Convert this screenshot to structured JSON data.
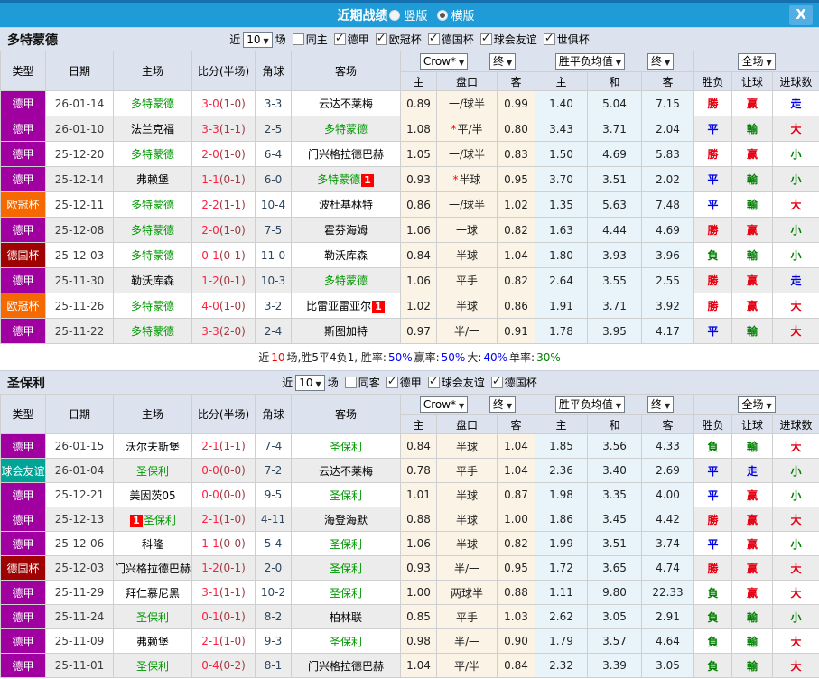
{
  "ui": {
    "arrow": "▼",
    "title": "近期战绩",
    "radio_vertical": "竖版",
    "radio_horizontal": "横版",
    "selected_layout": "横版",
    "close": "X",
    "near": "近",
    "games": "场"
  },
  "league_colors": {
    "德甲": "#a000a0",
    "欧冠杯": "#f56a00",
    "德国杯": "#9e0202",
    "球会友谊": "#00a496"
  },
  "result_colors": {
    "win_red": "#e60012",
    "lose_green": "#008000",
    "draw_blue": "#0000e6"
  },
  "table_header": {
    "type": "类型",
    "date": "日期",
    "home": "主场",
    "score": "比分(半场)",
    "corner": "角球",
    "away": "客场",
    "crow": "Crow*",
    "final1": "终",
    "avg": "胜平负均值",
    "final2": "终",
    "full": "全场",
    "sub": [
      "主",
      "盘口",
      "客",
      "主",
      "和",
      "客",
      "胜负",
      "让球",
      "进球数"
    ]
  },
  "sections": [
    {
      "team": "多特蒙德",
      "games_count": "10",
      "same_label": "同主",
      "same_checked": false,
      "leagues": [
        "德甲",
        "欧冠杯",
        "德国杯",
        "球会友谊",
        "世俱杯"
      ],
      "rows": [
        {
          "league": "德甲",
          "date": "26-01-14",
          "home": {
            "name": "多特蒙德",
            "green": true
          },
          "away": {
            "name": "云达不莱梅"
          },
          "score": "3-0",
          "half": "(1-0)",
          "corner": "3-3",
          "odds": [
            "0.89",
            "一/球半",
            "0.99"
          ],
          "star": false,
          "avg": [
            "1.40",
            "5.04",
            "7.15"
          ],
          "res": [
            [
              "勝",
              "r"
            ],
            [
              "赢",
              "r"
            ],
            [
              "走",
              "b"
            ]
          ]
        },
        {
          "league": "德甲",
          "date": "26-01-10",
          "home": {
            "name": "法兰克福"
          },
          "away": {
            "name": "多特蒙德",
            "green": true
          },
          "score": "3-3",
          "half": "(1-1)",
          "corner": "2-5",
          "odds": [
            "1.08",
            "平/半",
            "0.80"
          ],
          "star": true,
          "avg": [
            "3.43",
            "3.71",
            "2.04"
          ],
          "res": [
            [
              "平",
              "b"
            ],
            [
              "輸",
              "g"
            ],
            [
              "大",
              "r"
            ]
          ]
        },
        {
          "league": "德甲",
          "date": "25-12-20",
          "home": {
            "name": "多特蒙德",
            "green": true
          },
          "away": {
            "name": "门兴格拉德巴赫"
          },
          "score": "2-0",
          "half": "(1-0)",
          "corner": "6-4",
          "odds": [
            "1.05",
            "一/球半",
            "0.83"
          ],
          "star": false,
          "avg": [
            "1.50",
            "4.69",
            "5.83"
          ],
          "res": [
            [
              "勝",
              "r"
            ],
            [
              "赢",
              "r"
            ],
            [
              "小",
              "g"
            ]
          ]
        },
        {
          "league": "德甲",
          "date": "25-12-14",
          "home": {
            "name": "弗赖堡"
          },
          "away": {
            "name": "多特蒙德",
            "green": true,
            "badge": "1",
            "badge_pos": "after"
          },
          "score": "1-1",
          "half": "(0-1)",
          "corner": "6-0",
          "odds": [
            "0.93",
            "半球",
            "0.95"
          ],
          "star": true,
          "avg": [
            "3.70",
            "3.51",
            "2.02"
          ],
          "res": [
            [
              "平",
              "b"
            ],
            [
              "輸",
              "g"
            ],
            [
              "小",
              "g"
            ]
          ]
        },
        {
          "league": "欧冠杯",
          "date": "25-12-11",
          "home": {
            "name": "多特蒙德",
            "green": true
          },
          "away": {
            "name": "波杜基林特"
          },
          "score": "2-2",
          "half": "(1-1)",
          "corner": "10-4",
          "odds": [
            "0.86",
            "一/球半",
            "1.02"
          ],
          "star": false,
          "avg": [
            "1.35",
            "5.63",
            "7.48"
          ],
          "res": [
            [
              "平",
              "b"
            ],
            [
              "輸",
              "g"
            ],
            [
              "大",
              "r"
            ]
          ]
        },
        {
          "league": "德甲",
          "date": "25-12-08",
          "home": {
            "name": "多特蒙德",
            "green": true
          },
          "away": {
            "name": "霍芬海姆"
          },
          "score": "2-0",
          "half": "(1-0)",
          "corner": "7-5",
          "odds": [
            "1.06",
            "一球",
            "0.82"
          ],
          "star": false,
          "avg": [
            "1.63",
            "4.44",
            "4.69"
          ],
          "res": [
            [
              "勝",
              "r"
            ],
            [
              "赢",
              "r"
            ],
            [
              "小",
              "g"
            ]
          ]
        },
        {
          "league": "德国杯",
          "date": "25-12-03",
          "home": {
            "name": "多特蒙德",
            "green": true
          },
          "away": {
            "name": "勒沃库森"
          },
          "score": "0-1",
          "half": "(0-1)",
          "corner": "11-0",
          "odds": [
            "0.84",
            "半球",
            "1.04"
          ],
          "star": false,
          "avg": [
            "1.80",
            "3.93",
            "3.96"
          ],
          "res": [
            [
              "負",
              "g"
            ],
            [
              "輸",
              "g"
            ],
            [
              "小",
              "g"
            ]
          ]
        },
        {
          "league": "德甲",
          "date": "25-11-30",
          "home": {
            "name": "勒沃库森"
          },
          "away": {
            "name": "多特蒙德",
            "green": true
          },
          "score": "1-2",
          "half": "(0-1)",
          "corner": "10-3",
          "odds": [
            "1.06",
            "平手",
            "0.82"
          ],
          "star": false,
          "avg": [
            "2.64",
            "3.55",
            "2.55"
          ],
          "res": [
            [
              "勝",
              "r"
            ],
            [
              "赢",
              "r"
            ],
            [
              "走",
              "b"
            ]
          ]
        },
        {
          "league": "欧冠杯",
          "date": "25-11-26",
          "home": {
            "name": "多特蒙德",
            "green": true
          },
          "away": {
            "name": "比雷亚雷亚尔",
            "badge": "1",
            "badge_pos": "after"
          },
          "score": "4-0",
          "half": "(1-0)",
          "corner": "3-2",
          "odds": [
            "1.02",
            "半球",
            "0.86"
          ],
          "star": false,
          "avg": [
            "1.91",
            "3.71",
            "3.92"
          ],
          "res": [
            [
              "勝",
              "r"
            ],
            [
              "赢",
              "r"
            ],
            [
              "大",
              "r"
            ]
          ]
        },
        {
          "league": "德甲",
          "date": "25-11-22",
          "home": {
            "name": "多特蒙德",
            "green": true
          },
          "away": {
            "name": "斯图加特"
          },
          "score": "3-3",
          "half": "(2-0)",
          "corner": "2-4",
          "odds": [
            "0.97",
            "半/一",
            "0.91"
          ],
          "star": false,
          "avg": [
            "1.78",
            "3.95",
            "4.17"
          ],
          "res": [
            [
              "平",
              "b"
            ],
            [
              "輸",
              "g"
            ],
            [
              "大",
              "r"
            ]
          ]
        }
      ],
      "summary": [
        [
          "近",
          "k"
        ],
        [
          "10",
          "r"
        ],
        [
          "场,胜5平4负1, 胜率:",
          "k"
        ],
        [
          "50%",
          "b"
        ],
        [
          " 赢率:",
          "k"
        ],
        [
          "50%",
          "b"
        ],
        [
          " 大:",
          "k"
        ],
        [
          "40%",
          "b"
        ],
        [
          " 单率:",
          "k"
        ],
        [
          "30%",
          "g"
        ]
      ]
    },
    {
      "team": "圣保利",
      "games_count": "10",
      "same_label": "同客",
      "same_checked": false,
      "leagues": [
        "德甲",
        "球会友谊",
        "德国杯"
      ],
      "rows": [
        {
          "league": "德甲",
          "date": "26-01-15",
          "home": {
            "name": "沃尔夫斯堡"
          },
          "away": {
            "name": "圣保利",
            "green": true
          },
          "score": "2-1",
          "half": "(1-1)",
          "corner": "7-4",
          "odds": [
            "0.84",
            "半球",
            "1.04"
          ],
          "star": false,
          "avg": [
            "1.85",
            "3.56",
            "4.33"
          ],
          "res": [
            [
              "負",
              "g"
            ],
            [
              "輸",
              "g"
            ],
            [
              "大",
              "r"
            ]
          ]
        },
        {
          "league": "球会友谊",
          "date": "26-01-04",
          "home": {
            "name": "圣保利",
            "green": true
          },
          "away": {
            "name": "云达不莱梅"
          },
          "score": "0-0",
          "half": "(0-0)",
          "corner": "7-2",
          "odds": [
            "0.78",
            "平手",
            "1.04"
          ],
          "star": false,
          "avg": [
            "2.36",
            "3.40",
            "2.69"
          ],
          "res": [
            [
              "平",
              "b"
            ],
            [
              "走",
              "b"
            ],
            [
              "小",
              "g"
            ]
          ]
        },
        {
          "league": "德甲",
          "date": "25-12-21",
          "home": {
            "name": "美因茨05"
          },
          "away": {
            "name": "圣保利",
            "green": true
          },
          "score": "0-0",
          "half": "(0-0)",
          "corner": "9-5",
          "odds": [
            "1.01",
            "半球",
            "0.87"
          ],
          "star": false,
          "avg": [
            "1.98",
            "3.35",
            "4.00"
          ],
          "res": [
            [
              "平",
              "b"
            ],
            [
              "赢",
              "r"
            ],
            [
              "小",
              "g"
            ]
          ]
        },
        {
          "league": "德甲",
          "date": "25-12-13",
          "home": {
            "name": "圣保利",
            "green": true,
            "badge": "1",
            "badge_pos": "before"
          },
          "away": {
            "name": "海登海默"
          },
          "score": "2-1",
          "half": "(1-0)",
          "corner": "4-11",
          "odds": [
            "0.88",
            "半球",
            "1.00"
          ],
          "star": false,
          "avg": [
            "1.86",
            "3.45",
            "4.42"
          ],
          "res": [
            [
              "勝",
              "r"
            ],
            [
              "赢",
              "r"
            ],
            [
              "大",
              "r"
            ]
          ]
        },
        {
          "league": "德甲",
          "date": "25-12-06",
          "home": {
            "name": "科隆"
          },
          "away": {
            "name": "圣保利",
            "green": true
          },
          "score": "1-1",
          "half": "(0-0)",
          "corner": "5-4",
          "odds": [
            "1.06",
            "半球",
            "0.82"
          ],
          "star": false,
          "avg": [
            "1.99",
            "3.51",
            "3.74"
          ],
          "res": [
            [
              "平",
              "b"
            ],
            [
              "赢",
              "r"
            ],
            [
              "小",
              "g"
            ]
          ]
        },
        {
          "league": "德国杯",
          "date": "25-12-03",
          "home": {
            "name": "门兴格拉德巴赫"
          },
          "away": {
            "name": "圣保利",
            "green": true
          },
          "score": "1-2",
          "half": "(0-1)",
          "corner": "2-0",
          "odds": [
            "0.93",
            "半/一",
            "0.95"
          ],
          "star": false,
          "avg": [
            "1.72",
            "3.65",
            "4.74"
          ],
          "res": [
            [
              "勝",
              "r"
            ],
            [
              "赢",
              "r"
            ],
            [
              "大",
              "r"
            ]
          ]
        },
        {
          "league": "德甲",
          "date": "25-11-29",
          "home": {
            "name": "拜仁慕尼黑"
          },
          "away": {
            "name": "圣保利",
            "green": true
          },
          "score": "3-1",
          "half": "(1-1)",
          "corner": "10-2",
          "odds": [
            "1.00",
            "两球半",
            "0.88"
          ],
          "star": false,
          "avg": [
            "1.11",
            "9.80",
            "22.33"
          ],
          "res": [
            [
              "負",
              "g"
            ],
            [
              "赢",
              "r"
            ],
            [
              "大",
              "r"
            ]
          ]
        },
        {
          "league": "德甲",
          "date": "25-11-24",
          "home": {
            "name": "圣保利",
            "green": true
          },
          "away": {
            "name": "柏林联"
          },
          "score": "0-1",
          "half": "(0-1)",
          "corner": "8-2",
          "odds": [
            "0.85",
            "平手",
            "1.03"
          ],
          "star": false,
          "avg": [
            "2.62",
            "3.05",
            "2.91"
          ],
          "res": [
            [
              "負",
              "g"
            ],
            [
              "輸",
              "g"
            ],
            [
              "小",
              "g"
            ]
          ]
        },
        {
          "league": "德甲",
          "date": "25-11-09",
          "home": {
            "name": "弗赖堡"
          },
          "away": {
            "name": "圣保利",
            "green": true
          },
          "score": "2-1",
          "half": "(1-0)",
          "corner": "9-3",
          "odds": [
            "0.98",
            "半/一",
            "0.90"
          ],
          "star": false,
          "avg": [
            "1.79",
            "3.57",
            "4.64"
          ],
          "res": [
            [
              "負",
              "g"
            ],
            [
              "輸",
              "g"
            ],
            [
              "大",
              "r"
            ]
          ]
        },
        {
          "league": "德甲",
          "date": "25-11-01",
          "home": {
            "name": "圣保利",
            "green": true
          },
          "away": {
            "name": "门兴格拉德巴赫"
          },
          "score": "0-4",
          "half": "(0-2)",
          "corner": "8-1",
          "odds": [
            "1.04",
            "平/半",
            "0.84"
          ],
          "star": false,
          "avg": [
            "2.32",
            "3.39",
            "3.05"
          ],
          "res": [
            [
              "負",
              "g"
            ],
            [
              "輸",
              "g"
            ],
            [
              "大",
              "r"
            ]
          ]
        }
      ]
    }
  ]
}
